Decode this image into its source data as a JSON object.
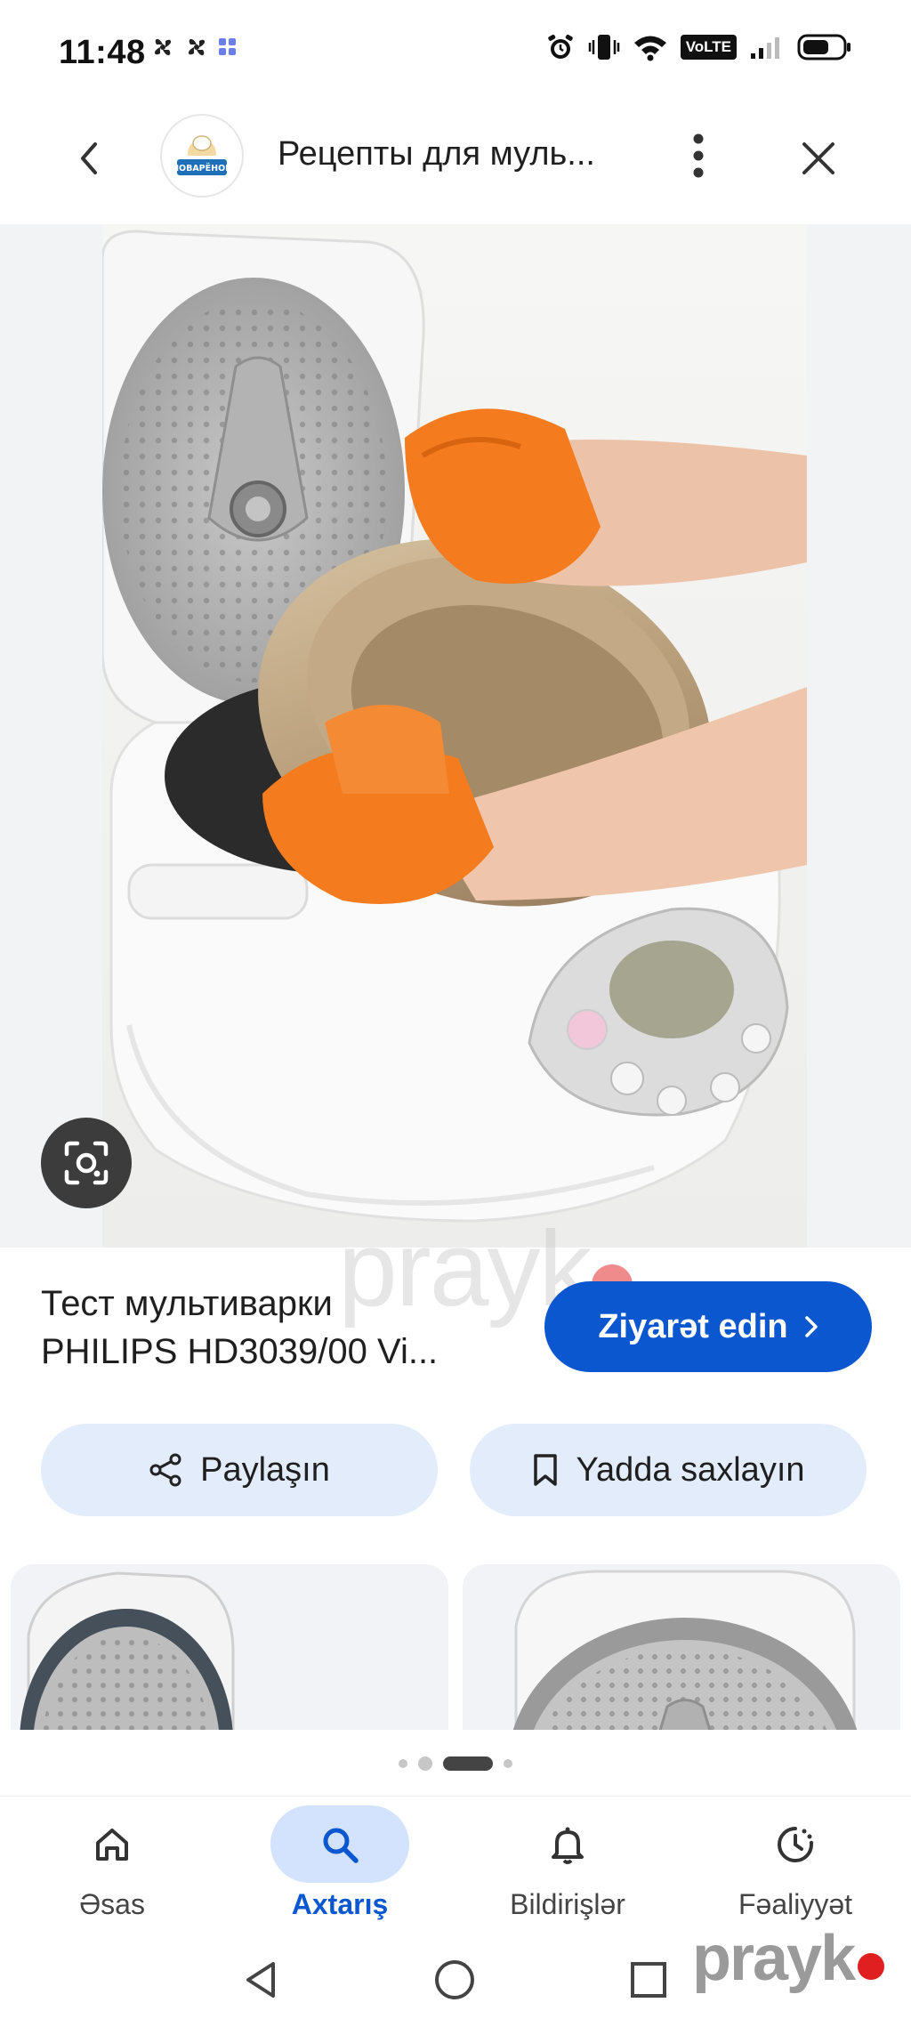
{
  "status_bar": {
    "time": "11:48",
    "volte": "VoLTE"
  },
  "app_bar": {
    "title": "Рецепты для муль...",
    "logo_text": "ПОВАРЁНОК"
  },
  "result": {
    "title_line1": "Тест мультиварки",
    "title_line2": "PHILIPS HD3039/00 Vi...",
    "visit_label": "Ziyarət edin"
  },
  "actions": {
    "share_label": "Paylaşın",
    "save_label": "Yadda saxlayın"
  },
  "watermark": {
    "text": "prayk"
  },
  "bottom_nav": {
    "items": [
      {
        "label": "Əsas",
        "icon": "home-icon",
        "active": false
      },
      {
        "label": "Axtarış",
        "icon": "search-icon",
        "active": true
      },
      {
        "label": "Bildirişlər",
        "icon": "bell-icon",
        "active": false
      },
      {
        "label": "Fəaliyyət",
        "icon": "activity-icon",
        "active": false
      }
    ]
  },
  "colors": {
    "accent": "#0b57d0",
    "chip_bg": "#e3ecfb",
    "active_nav_bg": "#d3e3fd",
    "glove_orange": "#f47b1e"
  }
}
